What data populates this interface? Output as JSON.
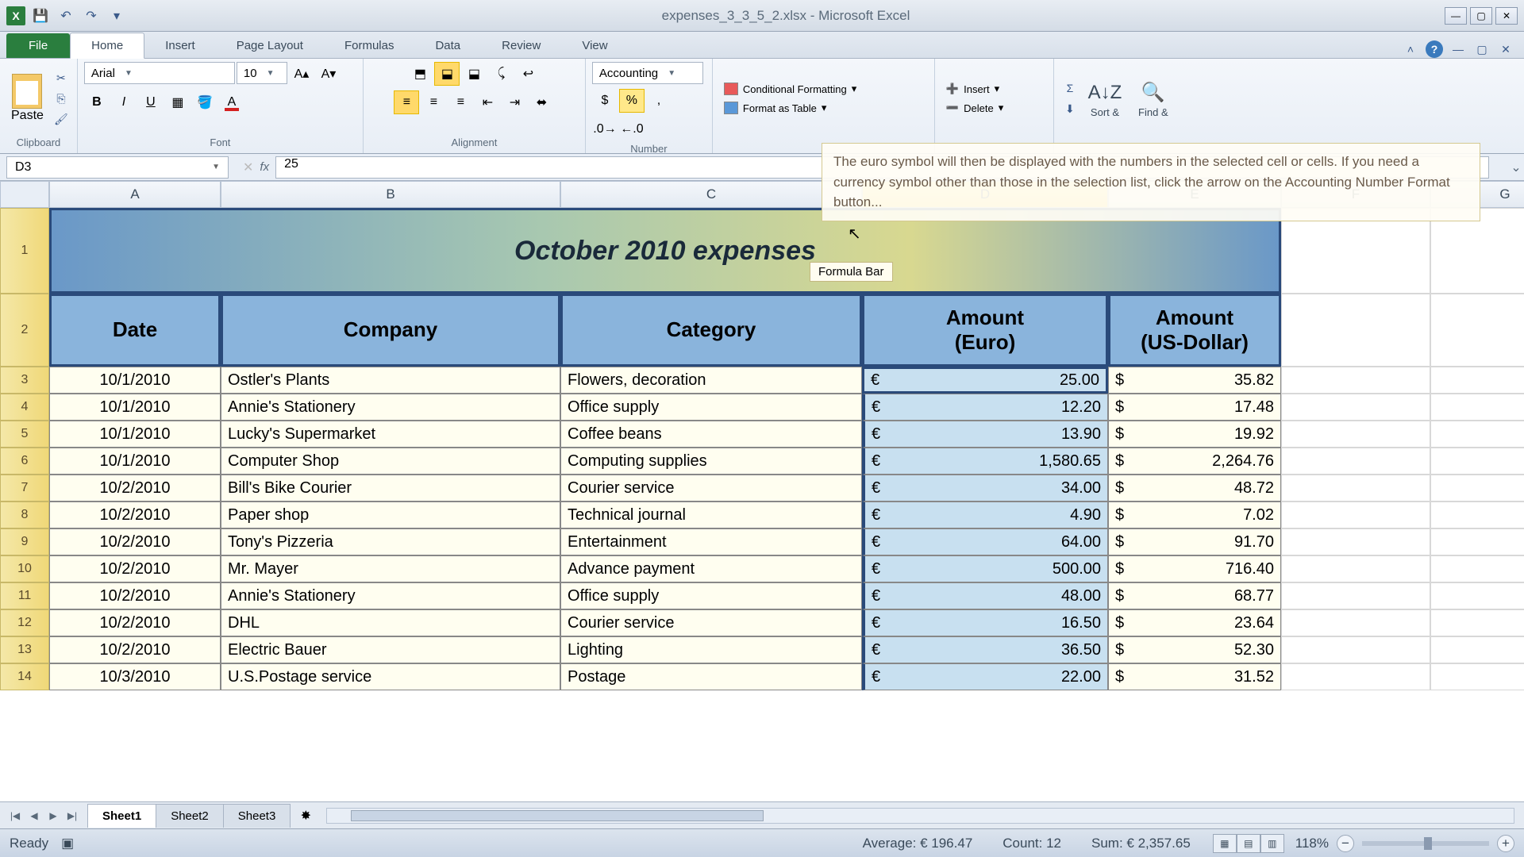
{
  "title_bar": {
    "document": "expenses_3_3_5_2.xlsx - Microsoft Excel"
  },
  "ribbon": {
    "file": "File",
    "tabs": [
      "Home",
      "Insert",
      "Page Layout",
      "Formulas",
      "Data",
      "Review",
      "View"
    ],
    "active_tab": "Home",
    "clipboard": {
      "paste": "Paste",
      "label": "Clipboard"
    },
    "font": {
      "name": "Arial",
      "size": "10",
      "label": "Font"
    },
    "alignment": {
      "label": "Alignment"
    },
    "number": {
      "format": "Accounting",
      "label": "Number"
    },
    "styles": {
      "conditional": "Conditional Formatting",
      "table": "Format as Table"
    },
    "cells": {
      "insert": "Insert",
      "delete": "Delete"
    },
    "editing": {
      "sort": "Sort &",
      "find": "Find &"
    }
  },
  "tooltip": "The euro symbol will then be displayed with the numbers in the selected cell or cells. If you need a currency symbol other than those in the selection list, click the arrow on the Accounting Number Format button...",
  "name_box": "D3",
  "formula_value": "25",
  "formula_bar_tip": "Formula Bar",
  "columns": [
    "A",
    "B",
    "C",
    "D",
    "E",
    "F",
    "G"
  ],
  "sheet": {
    "title": "October 2010 expenses",
    "headers": {
      "date": "Date",
      "company": "Company",
      "category": "Category",
      "euro": "Amount (Euro)",
      "usd": "Amount (US-Dollar)"
    },
    "rows": [
      {
        "n": "3",
        "date": "10/1/2010",
        "company": "Ostler's Plants",
        "category": "Flowers, decoration",
        "euro": "25.00",
        "usd": "35.82"
      },
      {
        "n": "4",
        "date": "10/1/2010",
        "company": "Annie's Stationery",
        "category": "Office supply",
        "euro": "12.20",
        "usd": "17.48"
      },
      {
        "n": "5",
        "date": "10/1/2010",
        "company": "Lucky's Supermarket",
        "category": "Coffee beans",
        "euro": "13.90",
        "usd": "19.92"
      },
      {
        "n": "6",
        "date": "10/1/2010",
        "company": "Computer Shop",
        "category": "Computing supplies",
        "euro": "1,580.65",
        "usd": "2,264.76"
      },
      {
        "n": "7",
        "date": "10/2/2010",
        "company": "Bill's Bike Courier",
        "category": "Courier service",
        "euro": "34.00",
        "usd": "48.72"
      },
      {
        "n": "8",
        "date": "10/2/2010",
        "company": "Paper shop",
        "category": "Technical journal",
        "euro": "4.90",
        "usd": "7.02"
      },
      {
        "n": "9",
        "date": "10/2/2010",
        "company": "Tony's Pizzeria",
        "category": "Entertainment",
        "euro": "64.00",
        "usd": "91.70"
      },
      {
        "n": "10",
        "date": "10/2/2010",
        "company": "Mr. Mayer",
        "category": "Advance payment",
        "euro": "500.00",
        "usd": "716.40"
      },
      {
        "n": "11",
        "date": "10/2/2010",
        "company": "Annie's Stationery",
        "category": "Office supply",
        "euro": "48.00",
        "usd": "68.77"
      },
      {
        "n": "12",
        "date": "10/2/2010",
        "company": "DHL",
        "category": "Courier service",
        "euro": "16.50",
        "usd": "23.64"
      },
      {
        "n": "13",
        "date": "10/2/2010",
        "company": "Electric Bauer",
        "category": "Lighting",
        "euro": "36.50",
        "usd": "52.30"
      },
      {
        "n": "14",
        "date": "10/3/2010",
        "company": "U.S.Postage service",
        "category": "Postage",
        "euro": "22.00",
        "usd": "31.52"
      }
    ]
  },
  "sheets": {
    "active": "Sheet1",
    "others": [
      "Sheet2",
      "Sheet3"
    ]
  },
  "status": {
    "ready": "Ready",
    "average": "Average:  € 196.47",
    "count": "Count: 12",
    "sum": "Sum:  € 2,357.65",
    "zoom": "118%"
  }
}
